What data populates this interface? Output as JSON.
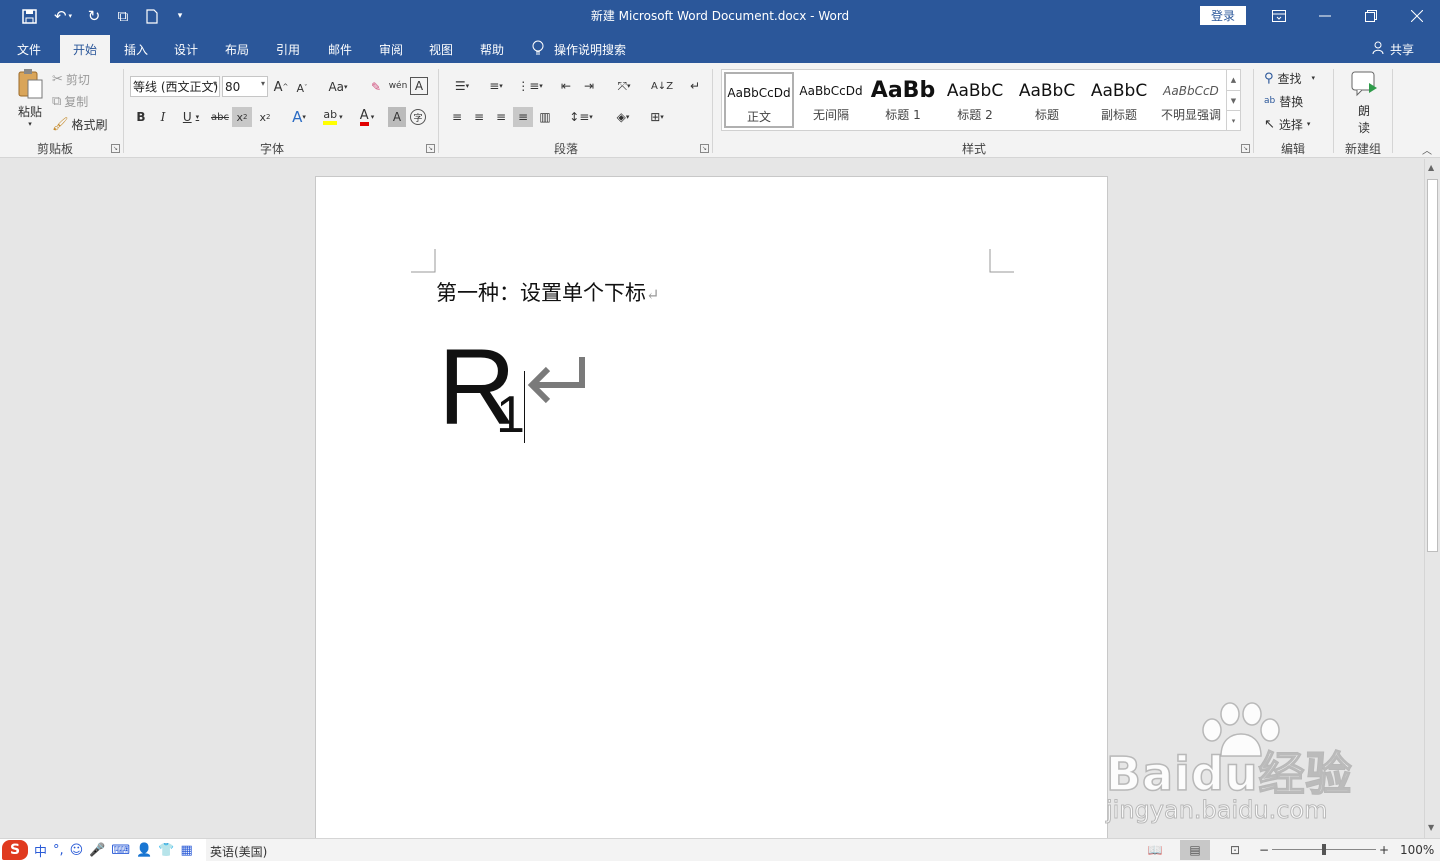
{
  "window": {
    "doc_title": "新建 Microsoft Word Document.docx  -  Word",
    "login": "登录"
  },
  "tabs": [
    "文件",
    "开始",
    "插入",
    "设计",
    "布局",
    "引用",
    "邮件",
    "审阅",
    "视图",
    "帮助"
  ],
  "active_tab": "开始",
  "tell_me": "操作说明搜索",
  "share": "共享",
  "ribbon": {
    "clipboard": {
      "paste": "粘贴",
      "cut": "剪切",
      "copy": "复制",
      "format_painter": "格式刷",
      "label": "剪贴板"
    },
    "font": {
      "font_name": "等线 (西文正文)",
      "font_size": "80",
      "label": "字体"
    },
    "paragraph": {
      "label": "段落"
    },
    "styles": {
      "label": "样式",
      "items": [
        {
          "sample": "AaBbCcDd",
          "name": "正文"
        },
        {
          "sample": "AaBbCcDd",
          "name": "无间隔"
        },
        {
          "sample": "AaBb",
          "name": "标题 1"
        },
        {
          "sample": "AaBbC",
          "name": "标题 2"
        },
        {
          "sample": "AaBbC",
          "name": "标题"
        },
        {
          "sample": "AaBbC",
          "name": "副标题"
        },
        {
          "sample": "AaBbCcD",
          "name": "不明显强调"
        }
      ]
    },
    "editing": {
      "find": "查找",
      "replace": "替换",
      "select": "选择",
      "label": "编辑"
    },
    "new_group": {
      "read_line1": "朗",
      "read_line2": "读",
      "label": "新建组"
    }
  },
  "document": {
    "line1": "第一种：设置单个下标",
    "big_char": "R",
    "subscript": "1"
  },
  "statusbar": {
    "ime_logo": "S",
    "ime_mode": "中",
    "language": "英语(美国)",
    "zoom": "100%"
  },
  "watermark": {
    "brand": "Baidu经验",
    "url": "jingyan.baidu.com"
  },
  "colors": {
    "accent": "#2b579a",
    "ribbon_bg": "#f3f3f3",
    "canvas_bg": "#e6e6e6"
  }
}
